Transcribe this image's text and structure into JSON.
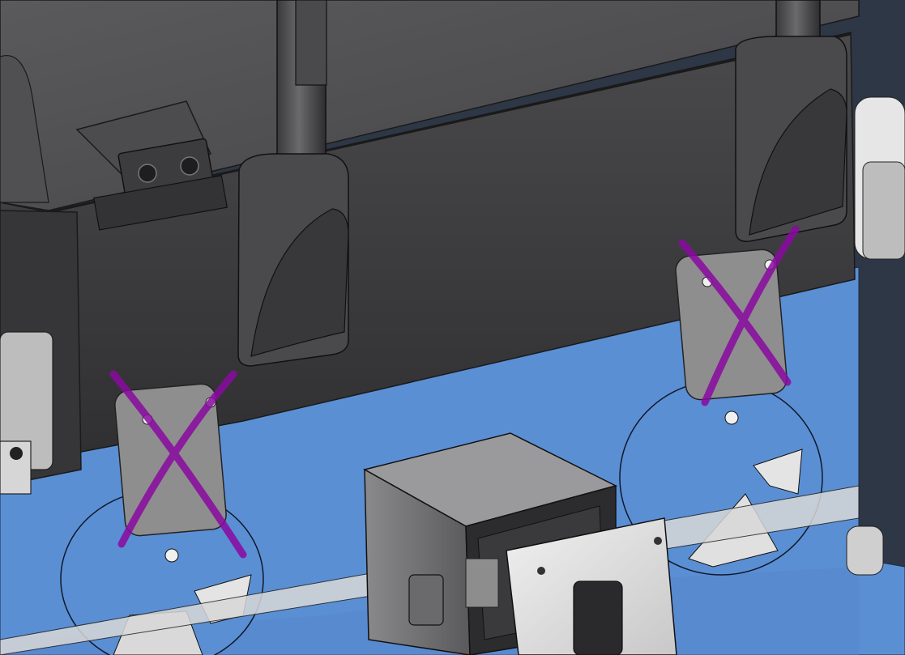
{
  "scene": {
    "description_tags": [
      "cad-render",
      "mechanical-assembly"
    ],
    "colors": {
      "background": "#2e3746",
      "blue_plate": "#5b8fd4",
      "dark_housing": "#3a3a3c",
      "grey_part": "#8e8e8e",
      "motor_body": "#6a6a6c",
      "mark_purple": "#8a0aa0"
    },
    "annotations": [
      {
        "id": "cross-left",
        "shape": "x-mark",
        "color": "#8a0aa0"
      },
      {
        "id": "cross-right",
        "shape": "x-mark",
        "color": "#8a0aa0"
      }
    ]
  }
}
